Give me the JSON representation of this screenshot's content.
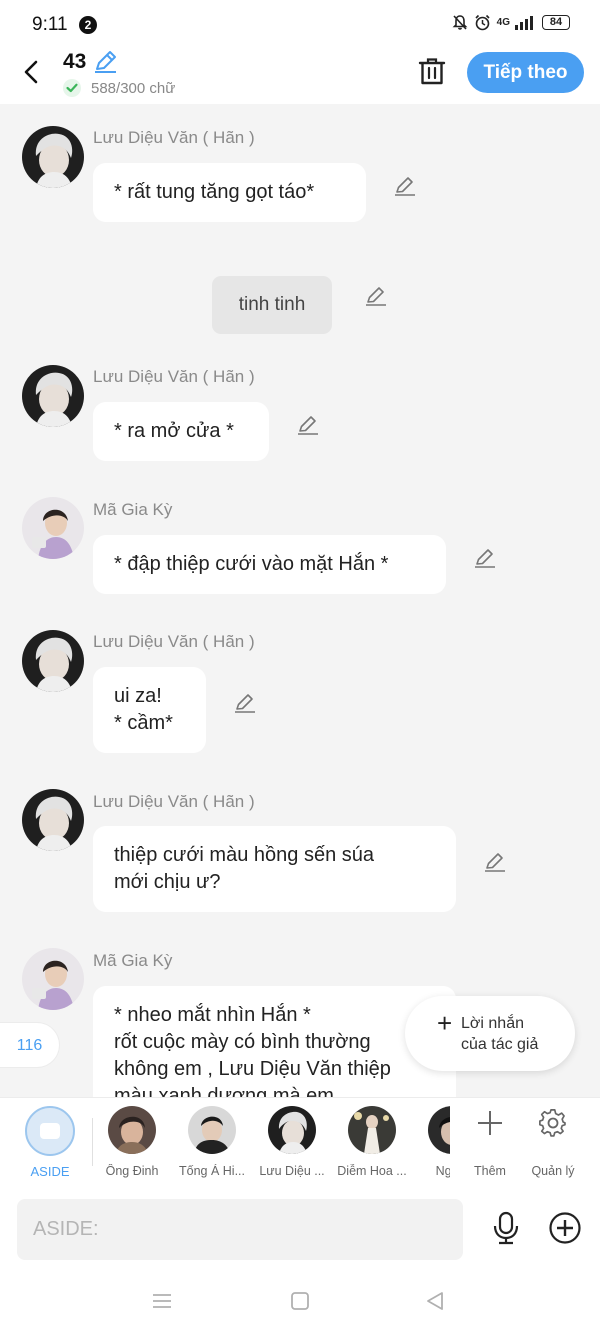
{
  "status": {
    "time": "9:11",
    "notif_count": "2",
    "network": "4G",
    "battery": "84"
  },
  "header": {
    "chapter": "43",
    "word_count": "588/300 chữ",
    "next_label": "Tiếp theo"
  },
  "messages": [
    {
      "name": "Lưu Diệu Văn ( Hãn )",
      "lines": [
        "* rất tung tăng gọt táo*"
      ]
    },
    {
      "narration": "tinh tinh"
    },
    {
      "name": "Lưu Diệu Văn ( Hãn )",
      "lines": [
        "* ra mở cửa *"
      ]
    },
    {
      "name": "Mã Gia Kỳ",
      "lines": [
        "* đập thiệp cưới vào mặt Hắn *"
      ]
    },
    {
      "name": "Lưu Diệu Văn ( Hãn )",
      "lines": [
        "ui za!",
        "* cầm*"
      ]
    },
    {
      "name": "Lưu Diệu Văn ( Hãn )",
      "lines": [
        "thiệp cưới màu hồng sến súa",
        "mới chịu ư?"
      ]
    },
    {
      "name": "Mã Gia Kỳ",
      "lines": [
        "* nheo mắt nhìn Hắn *",
        "rốt cuộc mày có bình thường",
        "không em , Lưu Diệu Văn thiệp",
        "màu xanh dương mà em"
      ]
    }
  ],
  "side": {
    "count": "116",
    "author_note_l1": "Lời nhắn",
    "author_note_l2": "của tác giả"
  },
  "characters": {
    "aside_label": "ASIDE",
    "items": [
      "Ông Đinh",
      "Tống Á Hi...",
      "Lưu Diệu ...",
      "Diễm Hoa ...",
      "Nghiê"
    ],
    "more_label": "Thêm",
    "manage_label": "Quản lý"
  },
  "input": {
    "placeholder": "ASIDE:"
  },
  "colors": {
    "accent": "#4a9ff2",
    "check": "#3bb55a"
  }
}
